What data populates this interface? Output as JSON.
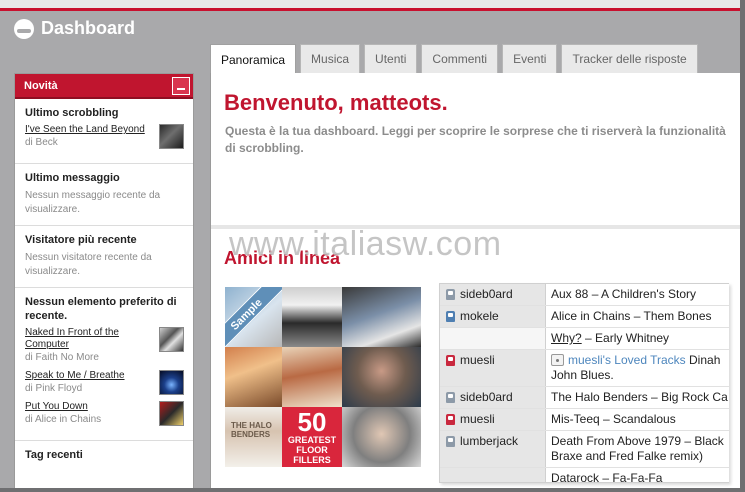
{
  "app": {
    "title": "Dashboard"
  },
  "sidebar": {
    "header": "Novità",
    "last_scrobble": {
      "title": "Ultimo scrobbling",
      "track": "I've Seen the Land Beyond",
      "artist": "di Beck"
    },
    "last_message": {
      "title": "Ultimo messaggio",
      "empty": "Nessun messaggio recente da visualizzare."
    },
    "last_visitor": {
      "title": "Visitatore più recente",
      "empty": "Nessun visitatore recente da visualizzare."
    },
    "favourites": {
      "title": "Nessun elemento preferito di recente.",
      "items": [
        {
          "track": "Naked In Front of the Computer",
          "artist": "di Faith No More"
        },
        {
          "track": "Speak to Me / Breathe",
          "artist": "di Pink Floyd"
        },
        {
          "track": "Put You Down",
          "artist": "di Alice in Chains"
        }
      ]
    },
    "recent_tags": {
      "title": "Tag recenti"
    }
  },
  "tabs": [
    "Panoramica",
    "Musica",
    "Utenti",
    "Commenti",
    "Eventi",
    "Tracker delle risposte"
  ],
  "main": {
    "welcome": "Benvenuto, matteots.",
    "intro": "Questa è la tua dashboard. Leggi per scoprire le sorprese che ti riserverà la funzionalità di scrobbling.",
    "friends_title": "Amici in linea",
    "watermark": "www.italiasw.com",
    "collage": {
      "sample_label": "Sample",
      "big_number": "50",
      "caption": "GREATEST FLOOR FILLERS",
      "album_text": "THE HALO BENDERS"
    },
    "feed": [
      {
        "user": "sideb0ard",
        "icon": "u-grey",
        "track_link": "",
        "track": "Aux 88 – A Children's Story"
      },
      {
        "user": "mokele",
        "icon": "u-blue",
        "track_link": "",
        "track": "Alice in Chains – Them Bones"
      },
      {
        "user": "",
        "icon": "",
        "track_link": "Why?",
        "track": " – Early Whitney"
      },
      {
        "user": "muesli",
        "icon": "u-red",
        "track_link": "",
        "loved": "muesli's Loved Tracks",
        "track": "Dinah",
        "track2": "John Blues."
      },
      {
        "user": "sideb0ard",
        "icon": "u-grey",
        "track_link": "",
        "track": "The Halo Benders – Big Rock Ca"
      },
      {
        "user": "muesli",
        "icon": "u-red",
        "track_link": "",
        "track": "Mis-Teeq – Scandalous"
      },
      {
        "user": "lumberjack",
        "icon": "u-grey",
        "track_link": "",
        "track": "Death From Above 1979 – Black",
        "track2": "Braxe and Fred Falke remix)"
      },
      {
        "user": "",
        "icon": "",
        "track_link": "",
        "track": "Datarock – Fa-Fa-Fa"
      }
    ]
  }
}
